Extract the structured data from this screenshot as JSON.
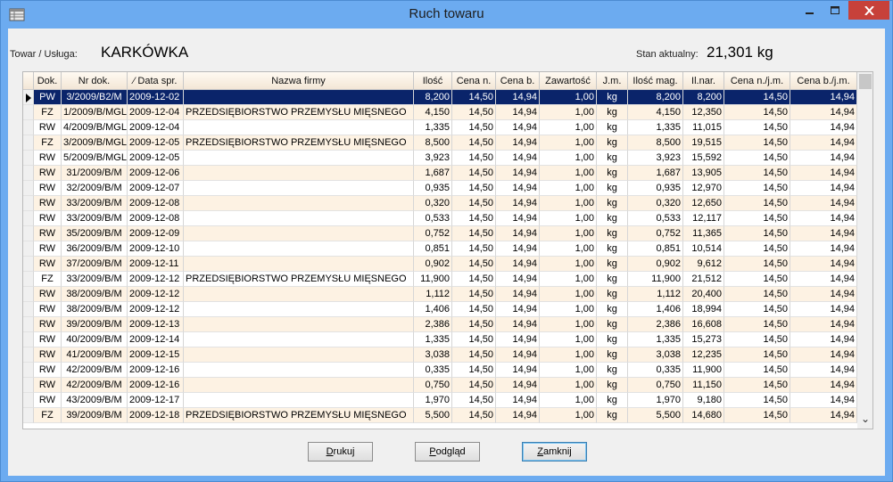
{
  "window": {
    "title": "Ruch towaru"
  },
  "info": {
    "product_label": "Towar / Usługa:",
    "product_value": "KARKÓWKA",
    "stock_label": "Stan aktualny:",
    "stock_value": "21,301 kg"
  },
  "table": {
    "columns": [
      {
        "key": "dok",
        "label": "Dok."
      },
      {
        "key": "nr",
        "label": "Nr dok."
      },
      {
        "key": "data",
        "label": "⁄ Data spr."
      },
      {
        "key": "firma",
        "label": "Nazwa firmy"
      },
      {
        "key": "ilosc",
        "label": "Ilość"
      },
      {
        "key": "cena_n",
        "label": "Cena n."
      },
      {
        "key": "cena_b",
        "label": "Cena b."
      },
      {
        "key": "zaw",
        "label": "Zawartość"
      },
      {
        "key": "jm",
        "label": "J.m."
      },
      {
        "key": "ilosc_mag",
        "label": "Ilość mag."
      },
      {
        "key": "ilnar",
        "label": "Il.nar."
      },
      {
        "key": "cena_njm",
        "label": "Cena n./j.m."
      },
      {
        "key": "cena_bjm",
        "label": "Cena b./j.m."
      }
    ],
    "selected_row": 0,
    "rows": [
      [
        "PW",
        "3/2009/B2/M",
        "2009-12-02",
        "",
        "8,200",
        "14,50",
        "14,94",
        "1,00",
        "kg",
        "8,200",
        "8,200",
        "14,50",
        "14,94"
      ],
      [
        "FZ",
        "1/2009/B/MGL",
        "2009-12-04",
        "PRZEDSIĘBIORSTWO PRZEMYSŁU MIĘSNEGO",
        "4,150",
        "14,50",
        "14,94",
        "1,00",
        "kg",
        "4,150",
        "12,350",
        "14,50",
        "14,94"
      ],
      [
        "RW",
        "4/2009/B/MGL",
        "2009-12-04",
        "",
        "1,335",
        "14,50",
        "14,94",
        "1,00",
        "kg",
        "1,335",
        "11,015",
        "14,50",
        "14,94"
      ],
      [
        "FZ",
        "3/2009/B/MGL",
        "2009-12-05",
        "PRZEDSIĘBIORSTWO PRZEMYSŁU MIĘSNEGO",
        "8,500",
        "14,50",
        "14,94",
        "1,00",
        "kg",
        "8,500",
        "19,515",
        "14,50",
        "14,94"
      ],
      [
        "RW",
        "5/2009/B/MGL",
        "2009-12-05",
        "",
        "3,923",
        "14,50",
        "14,94",
        "1,00",
        "kg",
        "3,923",
        "15,592",
        "14,50",
        "14,94"
      ],
      [
        "RW",
        "31/2009/B/M",
        "2009-12-06",
        "",
        "1,687",
        "14,50",
        "14,94",
        "1,00",
        "kg",
        "1,687",
        "13,905",
        "14,50",
        "14,94"
      ],
      [
        "RW",
        "32/2009/B/M",
        "2009-12-07",
        "",
        "0,935",
        "14,50",
        "14,94",
        "1,00",
        "kg",
        "0,935",
        "12,970",
        "14,50",
        "14,94"
      ],
      [
        "RW",
        "33/2009/B/M",
        "2009-12-08",
        "",
        "0,320",
        "14,50",
        "14,94",
        "1,00",
        "kg",
        "0,320",
        "12,650",
        "14,50",
        "14,94"
      ],
      [
        "RW",
        "33/2009/B/M",
        "2009-12-08",
        "",
        "0,533",
        "14,50",
        "14,94",
        "1,00",
        "kg",
        "0,533",
        "12,117",
        "14,50",
        "14,94"
      ],
      [
        "RW",
        "35/2009/B/M",
        "2009-12-09",
        "",
        "0,752",
        "14,50",
        "14,94",
        "1,00",
        "kg",
        "0,752",
        "11,365",
        "14,50",
        "14,94"
      ],
      [
        "RW",
        "36/2009/B/M",
        "2009-12-10",
        "",
        "0,851",
        "14,50",
        "14,94",
        "1,00",
        "kg",
        "0,851",
        "10,514",
        "14,50",
        "14,94"
      ],
      [
        "RW",
        "37/2009/B/M",
        "2009-12-11",
        "",
        "0,902",
        "14,50",
        "14,94",
        "1,00",
        "kg",
        "0,902",
        "9,612",
        "14,50",
        "14,94"
      ],
      [
        "FZ",
        "33/2009/B/M",
        "2009-12-12",
        "PRZEDSIĘBIORSTWO PRZEMYSŁU MIĘSNEGO",
        "11,900",
        "14,50",
        "14,94",
        "1,00",
        "kg",
        "11,900",
        "21,512",
        "14,50",
        "14,94"
      ],
      [
        "RW",
        "38/2009/B/M",
        "2009-12-12",
        "",
        "1,112",
        "14,50",
        "14,94",
        "1,00",
        "kg",
        "1,112",
        "20,400",
        "14,50",
        "14,94"
      ],
      [
        "RW",
        "38/2009/B/M",
        "2009-12-12",
        "",
        "1,406",
        "14,50",
        "14,94",
        "1,00",
        "kg",
        "1,406",
        "18,994",
        "14,50",
        "14,94"
      ],
      [
        "RW",
        "39/2009/B/M",
        "2009-12-13",
        "",
        "2,386",
        "14,50",
        "14,94",
        "1,00",
        "kg",
        "2,386",
        "16,608",
        "14,50",
        "14,94"
      ],
      [
        "RW",
        "40/2009/B/M",
        "2009-12-14",
        "",
        "1,335",
        "14,50",
        "14,94",
        "1,00",
        "kg",
        "1,335",
        "15,273",
        "14,50",
        "14,94"
      ],
      [
        "RW",
        "41/2009/B/M",
        "2009-12-15",
        "",
        "3,038",
        "14,50",
        "14,94",
        "1,00",
        "kg",
        "3,038",
        "12,235",
        "14,50",
        "14,94"
      ],
      [
        "RW",
        "42/2009/B/M",
        "2009-12-16",
        "",
        "0,335",
        "14,50",
        "14,94",
        "1,00",
        "kg",
        "0,335",
        "11,900",
        "14,50",
        "14,94"
      ],
      [
        "RW",
        "42/2009/B/M",
        "2009-12-16",
        "",
        "0,750",
        "14,50",
        "14,94",
        "1,00",
        "kg",
        "0,750",
        "11,150",
        "14,50",
        "14,94"
      ],
      [
        "RW",
        "43/2009/B/M",
        "2009-12-17",
        "",
        "1,970",
        "14,50",
        "14,94",
        "1,00",
        "kg",
        "1,970",
        "9,180",
        "14,50",
        "14,94"
      ],
      [
        "FZ",
        "39/2009/B/M",
        "2009-12-18",
        "PRZEDSIĘBIORSTWO PRZEMYSŁU MIĘSNEGO",
        "5,500",
        "14,50",
        "14,94",
        "1,00",
        "kg",
        "5,500",
        "14,680",
        "14,50",
        "14,94"
      ]
    ]
  },
  "buttons": {
    "print": {
      "mnemonic": "D",
      "rest": "rukuj"
    },
    "preview": {
      "mnemonic": "P",
      "rest": "odgląd"
    },
    "close": {
      "mnemonic": "Z",
      "rest": "amknij"
    }
  },
  "icons": {
    "app": "table-icon",
    "minimize": "minimize-icon",
    "maximize": "maximize-icon",
    "close": "close-icon",
    "row_pointer": "triangle-right-icon",
    "scroll_up": "chevron-up-icon",
    "scroll_down": "chevron-down-icon"
  },
  "colors": {
    "selection": "#0a246a",
    "alt_row": "#fdf2e3",
    "header": "#f3e6d6",
    "titlebar": "#6cabf0",
    "close": "#c7413a"
  }
}
